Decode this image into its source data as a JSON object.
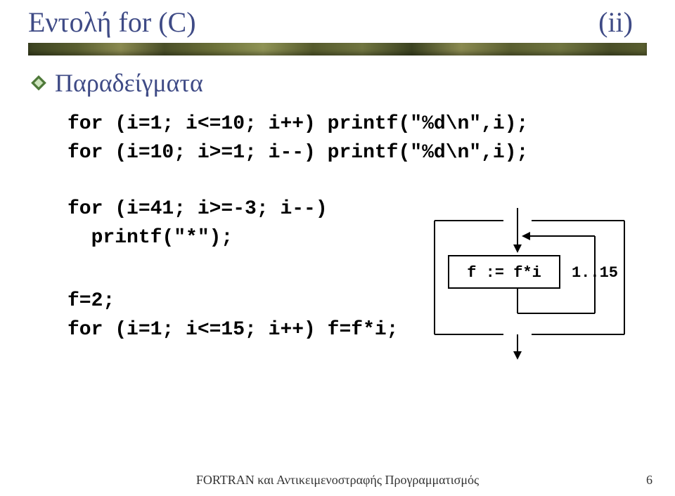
{
  "title": {
    "left": "Εντολή for (C)",
    "right": "(ii)"
  },
  "bullet": {
    "label": "Παραδείγματα"
  },
  "code": {
    "block1_line1": "for (i=1; i<=10; i++) printf(\"%d\\n\",i);",
    "block1_line2": "for (i=10; i>=1; i--) printf(\"%d\\n\",i);",
    "block2_line1": "for (i=41; i>=-3; i--)",
    "block2_line2": "  printf(\"*\");",
    "block3_line1": "f=2;",
    "block3_line2": "for (i=1; i<=15; i++) f=f*i;"
  },
  "diagram": {
    "box_text": "f := f*i",
    "side_label": "1..15"
  },
  "footer": {
    "text": "FORTRAN και Αντικειμενοστραφής Προγραμματισμός",
    "page": "6"
  }
}
